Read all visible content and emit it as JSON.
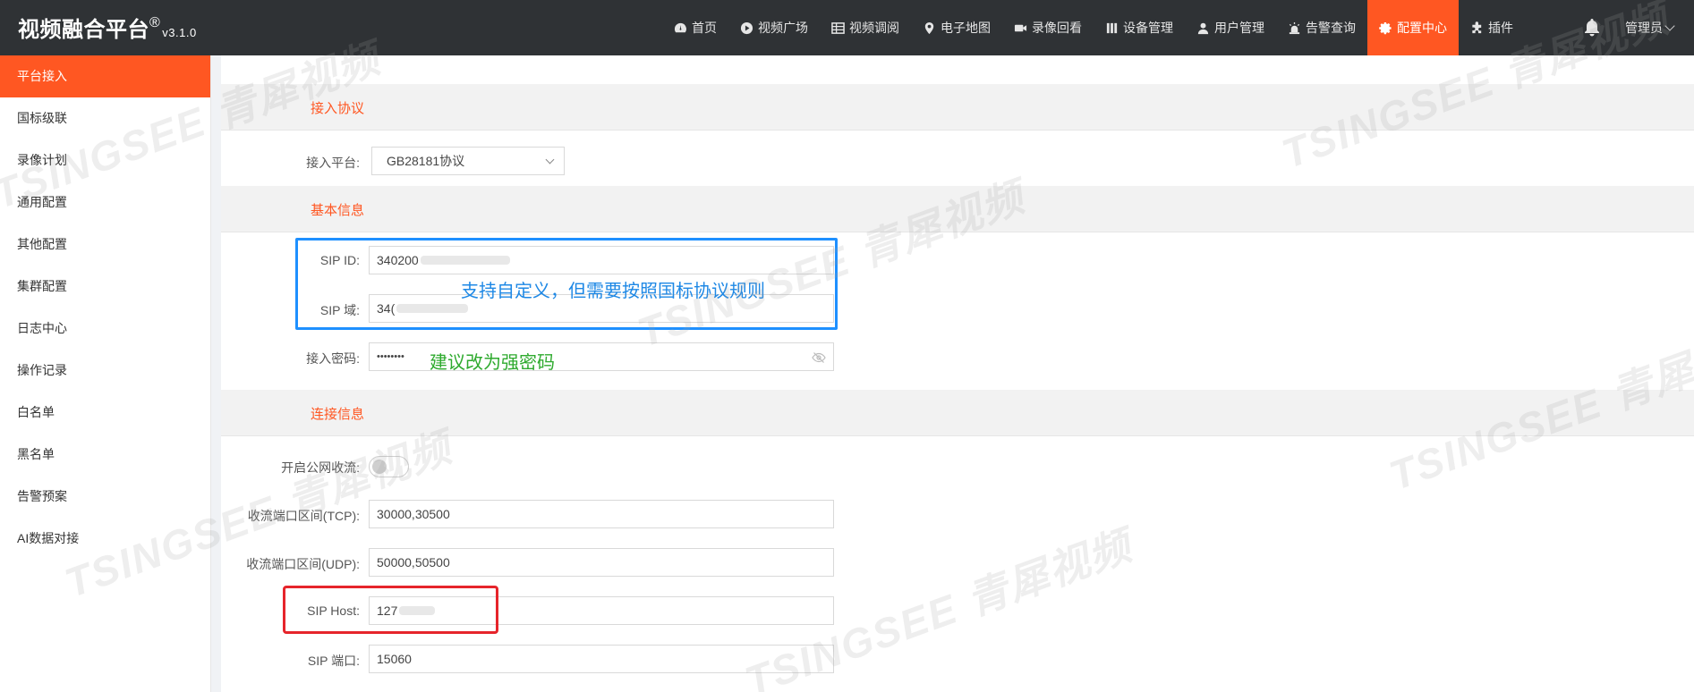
{
  "header": {
    "brand": "视频融合平台",
    "brand_mark": "®",
    "version": "v3.1.0",
    "nav": [
      {
        "label": "首页",
        "icon": "dashboard-icon"
      },
      {
        "label": "视频广场",
        "icon": "play-icon"
      },
      {
        "label": "视频调阅",
        "icon": "grid-icon"
      },
      {
        "label": "电子地图",
        "icon": "map-pin-icon"
      },
      {
        "label": "录像回看",
        "icon": "video-camera-icon"
      },
      {
        "label": "设备管理",
        "icon": "device-icon"
      },
      {
        "label": "用户管理",
        "icon": "user-icon"
      },
      {
        "label": "告警查询",
        "icon": "alarm-icon"
      },
      {
        "label": "配置中心",
        "icon": "gear-icon",
        "active": true
      },
      {
        "label": "插件",
        "icon": "puzzle-icon"
      }
    ],
    "user": "管理员",
    "accent": "#ff5722"
  },
  "sidebar": {
    "items": [
      {
        "label": "平台接入",
        "active": true
      },
      {
        "label": "国标级联"
      },
      {
        "label": "录像计划"
      },
      {
        "label": "通用配置"
      },
      {
        "label": "其他配置"
      },
      {
        "label": "集群配置"
      },
      {
        "label": "日志中心"
      },
      {
        "label": "操作记录"
      },
      {
        "label": "白名单"
      },
      {
        "label": "黑名单"
      },
      {
        "label": "告警预案"
      },
      {
        "label": "AI数据对接"
      }
    ]
  },
  "form": {
    "section_protocol": "接入协议",
    "platform_label": "接入平台:",
    "platform_value": "GB28181协议",
    "section_basic": "基本信息",
    "sip_id_label": "SIP ID:",
    "sip_id_value": "340200",
    "sip_domain_label": "SIP 域:",
    "sip_domain_value": "34(",
    "password_label": "接入密码:",
    "password_value": "••••••••",
    "section_connection": "连接信息",
    "public_stream_label": "开启公网收流:",
    "public_stream_on": false,
    "tcp_label": "收流端口区间(TCP):",
    "tcp_value": "30000,30500",
    "udp_label": "收流端口区间(UDP):",
    "udp_value": "50000,50500",
    "sip_host_label": "SIP Host:",
    "sip_host_value": "127",
    "sip_port_label": "SIP 端口:",
    "sip_port_value": "15060"
  },
  "annotations": {
    "blue_note": "支持自定义，但需要按照国标协议规则",
    "green_note": "建议改为强密码",
    "blue_color": "#1e88e5",
    "green_color": "#2eaa2e",
    "red_color": "#e6242b"
  },
  "watermark": "TSINGSEE 青犀视频"
}
